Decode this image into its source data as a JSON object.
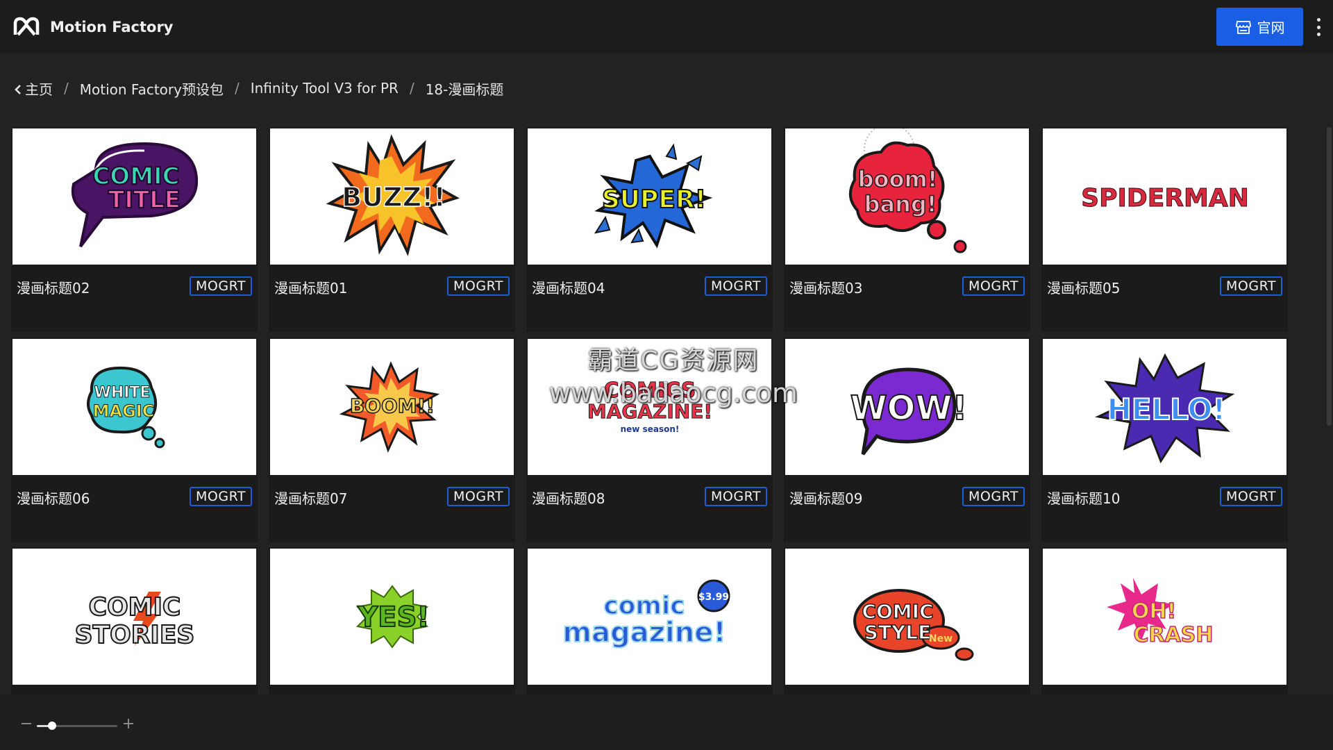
{
  "app": {
    "title": "Motion Factory",
    "official_site_label": "官网",
    "colors": {
      "accent": "#1a5ee6",
      "background": "#222222",
      "card": "#1b1b1b",
      "badge_border": "#1b5fd8"
    }
  },
  "breadcrumb": [
    {
      "label": "主页",
      "icon": "chevron-left-icon"
    },
    {
      "label": "Motion Factory预设包"
    },
    {
      "label": "Infinity Tool V3 for PR"
    },
    {
      "label": "18-漫画标题"
    }
  ],
  "breadcrumb_separator": "/",
  "cards": [
    {
      "name": "漫画标题02",
      "badge": "MOGRT",
      "art": [
        "COMIC",
        "TITLE"
      ]
    },
    {
      "name": "漫画标题01",
      "badge": "MOGRT",
      "art": [
        "BUZZ!!"
      ]
    },
    {
      "name": "漫画标题04",
      "badge": "MOGRT",
      "art": [
        "SUPER!"
      ]
    },
    {
      "name": "漫画标题03",
      "badge": "MOGRT",
      "art": [
        "boom!",
        "bang!"
      ]
    },
    {
      "name": "漫画标题05",
      "badge": "MOGRT",
      "art": [
        "SPIDERMAN"
      ]
    },
    {
      "name": "漫画标题06",
      "badge": "MOGRT",
      "art": [
        "WHITE",
        "MAGIC"
      ]
    },
    {
      "name": "漫画标题07",
      "badge": "MOGRT",
      "art": [
        "BOOM!!"
      ]
    },
    {
      "name": "漫画标题08",
      "badge": "MOGRT",
      "art": [
        "COMICS",
        "MAGAZINE!",
        "new season!"
      ]
    },
    {
      "name": "漫画标题09",
      "badge": "MOGRT",
      "art": [
        "WOW!"
      ]
    },
    {
      "name": "漫画标题10",
      "badge": "MOGRT",
      "art": [
        "HELLO!"
      ]
    },
    {
      "name": "",
      "badge": "",
      "art": [
        "COMIC",
        "STORIES"
      ]
    },
    {
      "name": "",
      "badge": "",
      "art": [
        "YES!"
      ]
    },
    {
      "name": "",
      "badge": "",
      "art": [
        "comic",
        "magazine!",
        "$3.99"
      ]
    },
    {
      "name": "",
      "badge": "",
      "art": [
        "COMIC",
        "STYLE",
        "New"
      ]
    },
    {
      "name": "",
      "badge": "",
      "art": [
        "OH!",
        "CRASH"
      ]
    }
  ],
  "zoom": {
    "value": 0.19
  },
  "watermark": {
    "line1": "霸道CG资源网",
    "line2": "www.badaocg.com"
  }
}
